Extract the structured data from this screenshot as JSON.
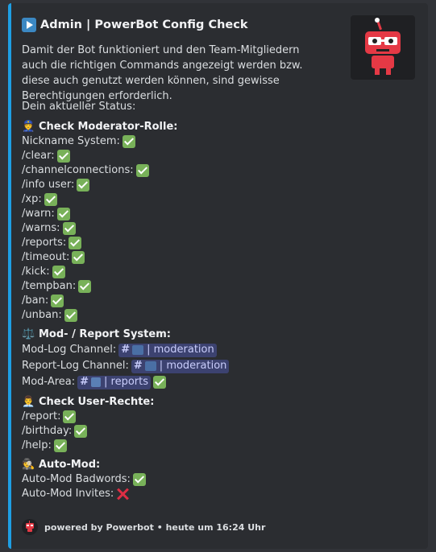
{
  "embed": {
    "title": "Admin | PowerBot Config Check",
    "description": "Damit der Bot funktioniert und den Team-Mitgliedern auch die richtigen Commands angezeigt werden bzw. diese auch genutzt werden können, sind gewisse Berechtigungen erforderlich.",
    "status_label": "Dein aktueller Status:",
    "accent_color": "#1e9ee3",
    "thumbnail_icon": "powerbot-robot-logo",
    "sections": {
      "moderator": {
        "emoji": "👮",
        "title": "Check Moderator-Rolle:",
        "items": [
          "Nickname System:",
          "/clear:",
          "/channelconnections:",
          "/info user:",
          "/xp:",
          "/warn:",
          "/warns:",
          "/reports:",
          "/timeout:",
          "/kick:",
          "/tempban:",
          "/ban:",
          "/unban:"
        ]
      },
      "report": {
        "emoji": "⚖️",
        "title": "Mod- / Report System:",
        "modlog_label": "Mod-Log Channel:",
        "modlog_channel": "moderation",
        "reportlog_label": "Report-Log Channel:",
        "reportlog_channel": "moderation",
        "modarea_label": "Mod-Area:",
        "modarea_channel": "reports"
      },
      "user": {
        "emoji": "👨‍💼",
        "title": "Check User-Rechte:",
        "items": [
          "/report:",
          "/birthday:",
          "/help:"
        ]
      },
      "automod": {
        "emoji": "🕵️",
        "title": "Auto-Mod:",
        "badwords_label": "Auto-Mod Badwords:",
        "invites_label": "Auto-Mod Invites:"
      }
    },
    "footer": "powered by Powerbot • heute um 16:24 Uhr"
  },
  "colors": {
    "check": "#78b159",
    "cross": "#dd2e44",
    "mention_bg": "#3c4270"
  }
}
